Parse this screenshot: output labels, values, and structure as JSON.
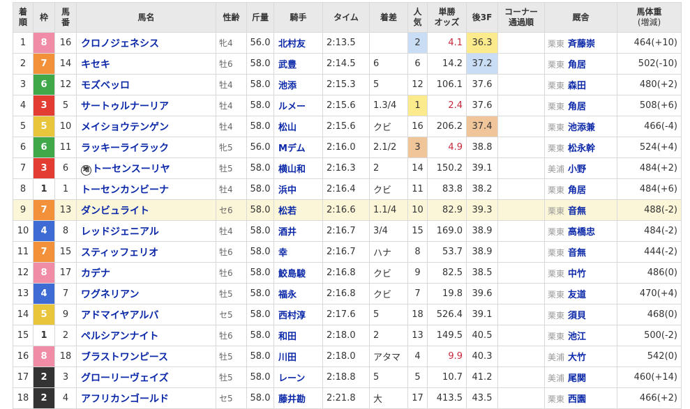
{
  "colors": {
    "waku": {
      "1": "#ffffff",
      "2": "#333333",
      "3": "#e33d33",
      "4": "#3f6cd4",
      "5": "#e8c53a",
      "6": "#41a84a",
      "7": "#f2913a",
      "8": "#f08ca6"
    },
    "waku_text": {
      "1": "#333333",
      "5": "#ffffff"
    },
    "rank1": "#fbeb8c",
    "rank2": "#c9ddf5",
    "rank3": "#f0c59a",
    "link": "#0b28a8",
    "odds_red": "#c8283a",
    "highlight_row": "#fbf6d8"
  },
  "headers": {
    "rank": [
      "着",
      "順"
    ],
    "waku": "枠",
    "umaban": [
      "馬",
      "番"
    ],
    "name": "馬名",
    "sexage": "性齢",
    "weight": "斤量",
    "jockey": "騎手",
    "time": "タイム",
    "margin": "着差",
    "pop": [
      "人",
      "気"
    ],
    "odds": [
      "単勝",
      "オッズ"
    ],
    "last3f": "後3F",
    "corner": [
      "コーナー",
      "通過順"
    ],
    "stable": "厩舎",
    "horse_weight": [
      "馬体重",
      "(増減)"
    ]
  },
  "rows": [
    {
      "rank": "1",
      "waku": "8",
      "umaban": "16",
      "name": "クロノジェネシス",
      "marker": "",
      "sexage": "牝4",
      "weight": "56.0",
      "jockey": "北村友",
      "time": "2:13.5",
      "margin": "",
      "pop": "2",
      "pop_hl": "2",
      "odds": "4.1",
      "odds_red": true,
      "last3f": "36.3",
      "l3f_hl": "1",
      "corner": "",
      "region": "栗東",
      "trainer": "斉藤崇",
      "hw": "464(+10)"
    },
    {
      "rank": "2",
      "waku": "7",
      "umaban": "14",
      "name": "キセキ",
      "marker": "",
      "sexage": "牡6",
      "weight": "58.0",
      "jockey": "武豊",
      "time": "2:14.5",
      "margin": "6",
      "pop": "6",
      "pop_hl": "",
      "odds": "14.2",
      "odds_red": false,
      "last3f": "37.2",
      "l3f_hl": "2",
      "corner": "",
      "region": "栗東",
      "trainer": "角居",
      "hw": "502(-10)"
    },
    {
      "rank": "3",
      "waku": "6",
      "umaban": "12",
      "name": "モズベッロ",
      "marker": "",
      "sexage": "牡4",
      "weight": "58.0",
      "jockey": "池添",
      "time": "2:15.3",
      "margin": "5",
      "pop": "12",
      "pop_hl": "",
      "odds": "106.1",
      "odds_red": false,
      "last3f": "37.6",
      "l3f_hl": "",
      "corner": "",
      "region": "栗東",
      "trainer": "森田",
      "hw": "480(+2)"
    },
    {
      "rank": "4",
      "waku": "3",
      "umaban": "5",
      "name": "サートゥルナーリア",
      "marker": "",
      "sexage": "牡4",
      "weight": "58.0",
      "jockey": "ルメー",
      "time": "2:15.6",
      "margin": "1.3/4",
      "pop": "1",
      "pop_hl": "1",
      "odds": "2.4",
      "odds_red": true,
      "last3f": "37.6",
      "l3f_hl": "",
      "corner": "",
      "region": "栗東",
      "trainer": "角居",
      "hw": "508(+6)"
    },
    {
      "rank": "5",
      "waku": "5",
      "umaban": "10",
      "name": "メイショウテンゲン",
      "marker": "",
      "sexage": "牡4",
      "weight": "58.0",
      "jockey": "松山",
      "time": "2:15.6",
      "margin": "クビ",
      "pop": "16",
      "pop_hl": "",
      "odds": "206.2",
      "odds_red": false,
      "last3f": "37.4",
      "l3f_hl": "3",
      "corner": "",
      "region": "栗東",
      "trainer": "池添兼",
      "hw": "466(-4)"
    },
    {
      "rank": "6",
      "waku": "6",
      "umaban": "11",
      "name": "ラッキーライラック",
      "marker": "",
      "sexage": "牝5",
      "weight": "56.0",
      "jockey": "Mデム",
      "time": "2:16.0",
      "margin": "2.1/2",
      "pop": "3",
      "pop_hl": "3",
      "odds": "4.9",
      "odds_red": true,
      "last3f": "38.8",
      "l3f_hl": "",
      "corner": "",
      "region": "栗東",
      "trainer": "松永幹",
      "hw": "524(+4)"
    },
    {
      "rank": "7",
      "waku": "3",
      "umaban": "6",
      "name": "トーセンスーリヤ",
      "marker": "地",
      "sexage": "牡5",
      "weight": "58.0",
      "jockey": "横山和",
      "time": "2:16.3",
      "margin": "2",
      "pop": "14",
      "pop_hl": "",
      "odds": "150.2",
      "odds_red": false,
      "last3f": "39.1",
      "l3f_hl": "",
      "corner": "",
      "region": "美浦",
      "trainer": "小野",
      "hw": "484(+2)"
    },
    {
      "rank": "8",
      "waku": "1",
      "umaban": "1",
      "name": "トーセンカンビーナ",
      "marker": "",
      "sexage": "牡4",
      "weight": "58.0",
      "jockey": "浜中",
      "time": "2:16.4",
      "margin": "クビ",
      "pop": "11",
      "pop_hl": "",
      "odds": "83.8",
      "odds_red": false,
      "last3f": "38.2",
      "l3f_hl": "",
      "corner": "",
      "region": "栗東",
      "trainer": "角居",
      "hw": "484(+6)"
    },
    {
      "rank": "9",
      "waku": "7",
      "umaban": "13",
      "name": "ダンビュライト",
      "marker": "",
      "sexage": "セ6",
      "weight": "58.0",
      "jockey": "松若",
      "time": "2:16.6",
      "margin": "1.1/4",
      "pop": "10",
      "pop_hl": "",
      "odds": "82.9",
      "odds_red": false,
      "last3f": "39.3",
      "l3f_hl": "",
      "corner": "",
      "region": "栗東",
      "trainer": "音無",
      "hw": "488(-2)",
      "highlight": true
    },
    {
      "rank": "10",
      "waku": "4",
      "umaban": "8",
      "name": "レッドジェニアル",
      "marker": "",
      "sexage": "牡4",
      "weight": "58.0",
      "jockey": "酒井",
      "time": "2:16.7",
      "margin": "3/4",
      "pop": "15",
      "pop_hl": "",
      "odds": "169.0",
      "odds_red": false,
      "last3f": "38.9",
      "l3f_hl": "",
      "corner": "",
      "region": "栗東",
      "trainer": "高橋忠",
      "hw": "484(-2)"
    },
    {
      "rank": "11",
      "waku": "7",
      "umaban": "15",
      "name": "スティッフェリオ",
      "marker": "",
      "sexage": "牡6",
      "weight": "58.0",
      "jockey": "幸",
      "time": "2:16.7",
      "margin": "ハナ",
      "pop": "8",
      "pop_hl": "",
      "odds": "53.7",
      "odds_red": false,
      "last3f": "38.9",
      "l3f_hl": "",
      "corner": "",
      "region": "栗東",
      "trainer": "音無",
      "hw": "444(-2)"
    },
    {
      "rank": "12",
      "waku": "8",
      "umaban": "17",
      "name": "カデナ",
      "marker": "",
      "sexage": "牡6",
      "weight": "58.0",
      "jockey": "鮫島駿",
      "time": "2:16.8",
      "margin": "クビ",
      "pop": "9",
      "pop_hl": "",
      "odds": "82.5",
      "odds_red": false,
      "last3f": "38.5",
      "l3f_hl": "",
      "corner": "",
      "region": "栗東",
      "trainer": "中竹",
      "hw": "486(0)"
    },
    {
      "rank": "13",
      "waku": "4",
      "umaban": "7",
      "name": "ワグネリアン",
      "marker": "",
      "sexage": "牡5",
      "weight": "58.0",
      "jockey": "福永",
      "time": "2:16.8",
      "margin": "クビ",
      "pop": "7",
      "pop_hl": "",
      "odds": "19.8",
      "odds_red": false,
      "last3f": "39.6",
      "l3f_hl": "",
      "corner": "",
      "region": "栗東",
      "trainer": "友道",
      "hw": "470(+4)"
    },
    {
      "rank": "14",
      "waku": "5",
      "umaban": "9",
      "name": "アドマイヤアルバ",
      "marker": "",
      "sexage": "セ5",
      "weight": "58.0",
      "jockey": "西村淳",
      "time": "2:17.6",
      "margin": "5",
      "pop": "18",
      "pop_hl": "",
      "odds": "526.4",
      "odds_red": false,
      "last3f": "39.1",
      "l3f_hl": "",
      "corner": "",
      "region": "栗東",
      "trainer": "須貝",
      "hw": "468(0)"
    },
    {
      "rank": "15",
      "waku": "1",
      "umaban": "2",
      "name": "ペルシアンナイト",
      "marker": "",
      "sexage": "牡6",
      "weight": "58.0",
      "jockey": "和田",
      "time": "2:18.0",
      "margin": "2",
      "pop": "13",
      "pop_hl": "",
      "odds": "149.5",
      "odds_red": false,
      "last3f": "40.5",
      "l3f_hl": "",
      "corner": "",
      "region": "栗東",
      "trainer": "池江",
      "hw": "500(-2)"
    },
    {
      "rank": "16",
      "waku": "8",
      "umaban": "18",
      "name": "ブラストワンピース",
      "marker": "",
      "sexage": "牡5",
      "weight": "58.0",
      "jockey": "川田",
      "time": "2:18.0",
      "margin": "アタマ",
      "pop": "4",
      "pop_hl": "",
      "odds": "9.9",
      "odds_red": true,
      "last3f": "40.3",
      "l3f_hl": "",
      "corner": "",
      "region": "美浦",
      "trainer": "大竹",
      "hw": "542(0)"
    },
    {
      "rank": "17",
      "waku": "2",
      "umaban": "3",
      "name": "グローリーヴェイズ",
      "marker": "",
      "sexage": "牡5",
      "weight": "58.0",
      "jockey": "レーン",
      "time": "2:18.8",
      "margin": "5",
      "pop": "5",
      "pop_hl": "",
      "odds": "10.7",
      "odds_red": false,
      "last3f": "41.2",
      "l3f_hl": "",
      "corner": "",
      "region": "美浦",
      "trainer": "尾関",
      "hw": "460(+14)"
    },
    {
      "rank": "18",
      "waku": "2",
      "umaban": "4",
      "name": "アフリカンゴールド",
      "marker": "",
      "sexage": "セ5",
      "weight": "58.0",
      "jockey": "藤井勘",
      "time": "2:21.8",
      "margin": "大",
      "pop": "17",
      "pop_hl": "",
      "odds": "413.5",
      "odds_red": false,
      "last3f": "43.5",
      "l3f_hl": "",
      "corner": "",
      "region": "栗東",
      "trainer": "西園",
      "hw": "466(+2)"
    }
  ]
}
